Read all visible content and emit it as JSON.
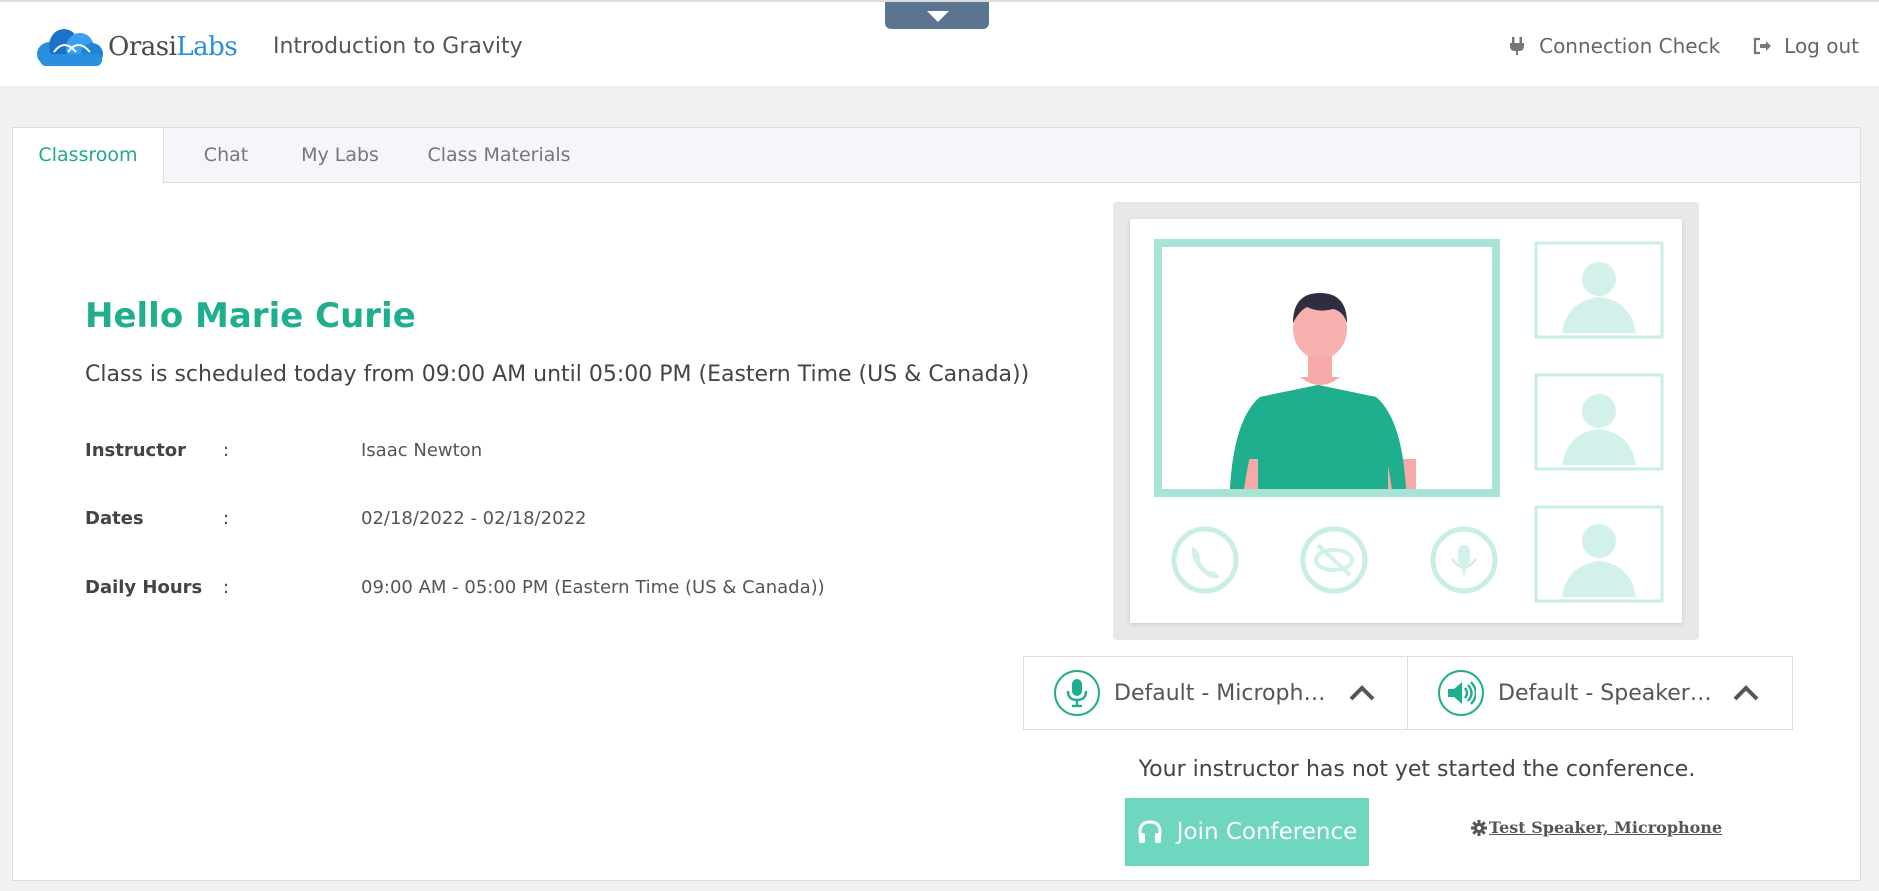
{
  "header": {
    "logo_part1": "Orasi",
    "logo_part2": "Labs",
    "course_title": "Introduction to Gravity",
    "connection_check": "Connection Check",
    "logout": "Log out"
  },
  "tabs": [
    {
      "label": "Classroom",
      "active": true
    },
    {
      "label": "Chat",
      "active": false
    },
    {
      "label": "My Labs",
      "active": false
    },
    {
      "label": "Class Materials",
      "active": false
    }
  ],
  "classroom": {
    "greeting": "Hello Marie Curie",
    "schedule": "Class is scheduled today from 09:00 AM until 05:00 PM (Eastern Time (US & Canada))",
    "details": [
      {
        "label": "Instructor",
        "separator": ":",
        "value": "Isaac Newton"
      },
      {
        "label": "Dates",
        "separator": ":",
        "value": "02/18/2022 - 02/18/2022"
      },
      {
        "label": "Daily Hours",
        "separator": ":",
        "value": "09:00 AM - 05:00 PM (Eastern Time (US & Canada))"
      }
    ]
  },
  "conference": {
    "microphone": "Default - Microphone",
    "speakers": "Default - Speakers/Headphones",
    "status": "Your instructor has not yet started the conference.",
    "join_label": "Join Conference",
    "test_label": "Test Speaker, Microphone"
  },
  "colors": {
    "accent": "#1fae8e",
    "join_button": "#6fd6bf",
    "pull_tab": "#5b7590"
  }
}
